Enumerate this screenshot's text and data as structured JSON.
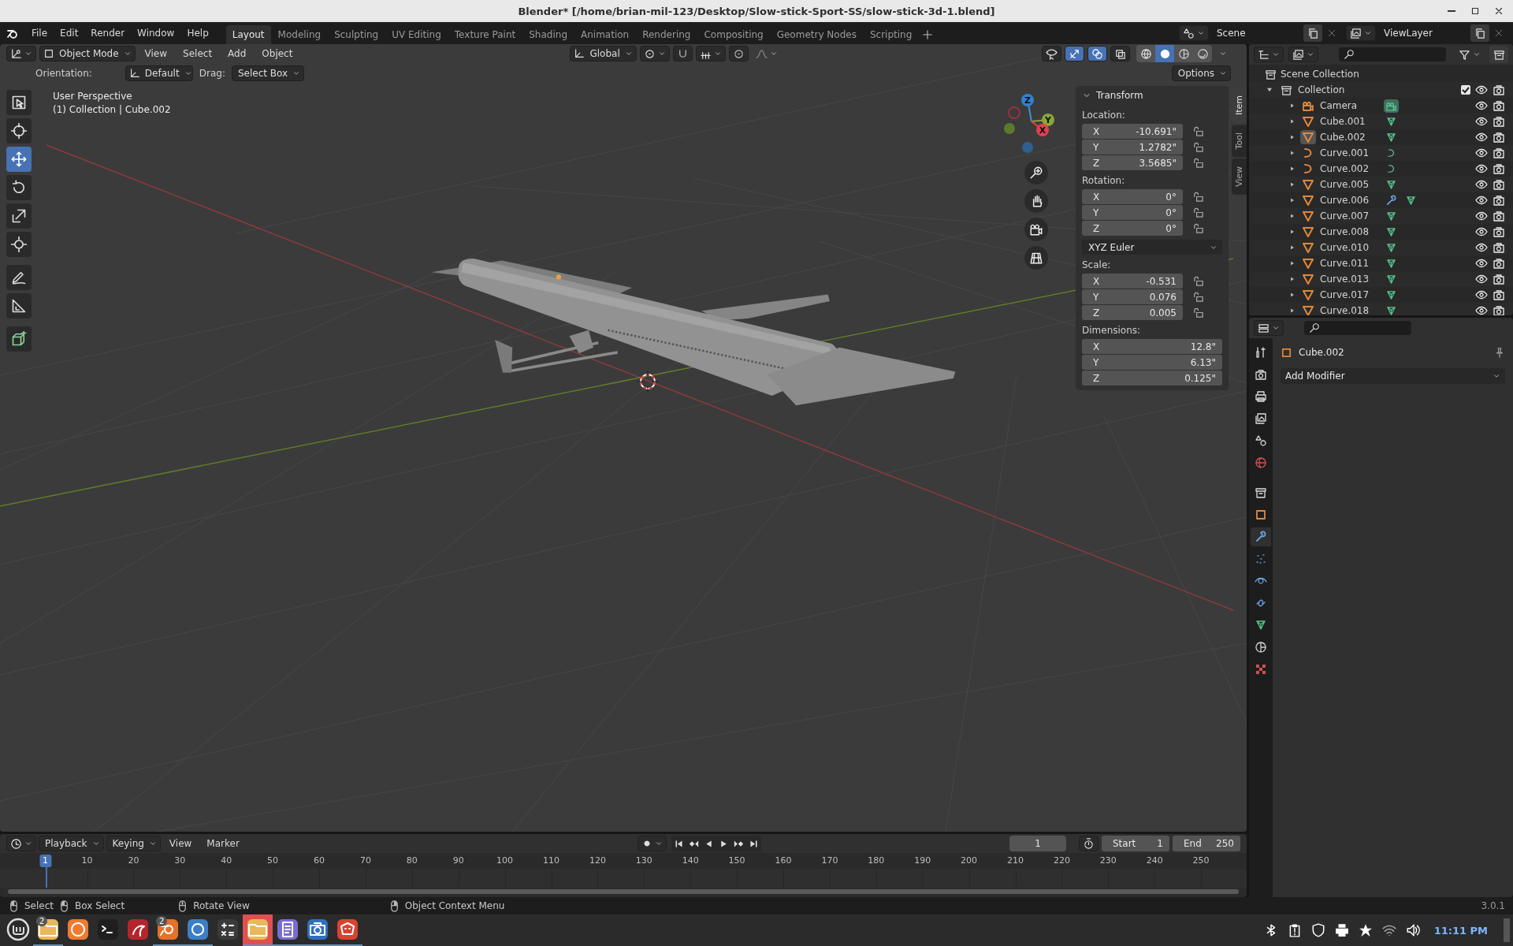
{
  "window": {
    "title": "Blender* [/home/brian-mil-123/Desktop/Slow-stick-Sport-SS/slow-stick-3d-1.blend]"
  },
  "menu": [
    "File",
    "Edit",
    "Render",
    "Window",
    "Help"
  ],
  "workspaces": [
    {
      "label": "Layout",
      "selected": true
    },
    {
      "label": "Modeling",
      "selected": false
    },
    {
      "label": "Sculpting",
      "selected": false
    },
    {
      "label": "UV Editing",
      "selected": false
    },
    {
      "label": "Texture Paint",
      "selected": false
    },
    {
      "label": "Shading",
      "selected": false
    },
    {
      "label": "Animation",
      "selected": false
    },
    {
      "label": "Rendering",
      "selected": false
    },
    {
      "label": "Compositing",
      "selected": false
    },
    {
      "label": "Geometry Nodes",
      "selected": false
    },
    {
      "label": "Scripting",
      "selected": false
    }
  ],
  "scene": {
    "name": "Scene"
  },
  "view_layer": {
    "name": "ViewLayer"
  },
  "viewport": {
    "mode": "Object Mode",
    "menus": [
      "View",
      "Select",
      "Add",
      "Object"
    ],
    "orientation": "Global",
    "toggles": [
      {
        "kind": "visibility",
        "on": false
      },
      {
        "kind": "gizmo",
        "on": true
      },
      {
        "kind": "overlay",
        "on": true
      },
      {
        "kind": "xray",
        "on": false
      }
    ],
    "shading": [
      {
        "kind": "wireframe",
        "selected": false
      },
      {
        "kind": "solid",
        "selected": true
      },
      {
        "kind": "material",
        "selected": false
      },
      {
        "kind": "rendered",
        "selected": false
      }
    ],
    "tool_settings": {
      "orientation_label": "Orientation:",
      "orientation": "Default",
      "drag_label": "Drag:",
      "drag": "Select Box",
      "options": "Options"
    },
    "info": [
      "User Perspective",
      "(1) Collection | Cube.002"
    ],
    "tools": [
      {
        "kind": "select",
        "selected": false
      },
      {
        "kind": "cursor",
        "selected": false
      },
      {
        "kind": "move",
        "selected": true
      },
      {
        "kind": "rotate",
        "selected": false
      },
      {
        "kind": "scale",
        "selected": false
      },
      {
        "kind": "transform",
        "selected": false
      },
      {
        "kind": "annotate",
        "selected": false
      },
      {
        "kind": "measure",
        "selected": false
      },
      {
        "kind": "addcube",
        "selected": false
      }
    ],
    "gizmo": {
      "axes": [
        "Z",
        "Y",
        "X"
      ]
    },
    "nav_buttons": [
      {
        "kind": "zoom"
      },
      {
        "kind": "pan"
      },
      {
        "kind": "cameranav"
      },
      {
        "kind": "ortho"
      }
    ]
  },
  "sidebar": {
    "tabs": [
      {
        "label": "Item",
        "selected": true
      },
      {
        "label": "Tool",
        "selected": false
      },
      {
        "label": "View",
        "selected": false
      }
    ],
    "panel": {
      "title": "Transform",
      "expanded": true,
      "groups": [
        {
          "label": "Location:",
          "fields": [
            {
              "axis": "X",
              "value": "-10.691\"",
              "locked": false
            },
            {
              "axis": "Y",
              "value": "1.2782\"",
              "locked": false
            },
            {
              "axis": "Z",
              "value": "3.5685\"",
              "locked": false
            }
          ]
        },
        {
          "label": "Rotation:",
          "fields": [
            {
              "axis": "X",
              "value": "0°",
              "locked": false
            },
            {
              "axis": "Y",
              "value": "0°",
              "locked": false
            },
            {
              "axis": "Z",
              "value": "0°",
              "locked": false
            }
          ],
          "mode": "XYZ Euler"
        },
        {
          "label": "Scale:",
          "fields": [
            {
              "axis": "X",
              "value": "-0.531",
              "locked": false
            },
            {
              "axis": "Y",
              "value": "0.076",
              "locked": false
            },
            {
              "axis": "Z",
              "value": "0.005",
              "locked": false
            }
          ]
        },
        {
          "label": "Dimensions:",
          "fields": [
            {
              "axis": "X",
              "value": "12.8\""
            },
            {
              "axis": "Y",
              "value": "6.13\""
            },
            {
              "axis": "Z",
              "value": "0.125\""
            }
          ]
        }
      ]
    }
  },
  "outliner": {
    "root": "Scene Collection",
    "collections": [
      {
        "name": "Collection",
        "expanded": true,
        "checked": true,
        "visible": true,
        "renderable": true,
        "children": [
          {
            "name": "Camera",
            "kind": "camera",
            "selected": false,
            "visible": true,
            "renderable": true,
            "data": [
              {
                "kind": "cameradata",
                "active": true
              }
            ]
          },
          {
            "name": "Cube.001",
            "kind": "mesh",
            "selected": false,
            "visible": true,
            "renderable": true,
            "data": [
              {
                "kind": "meshdata",
                "active": false
              }
            ]
          },
          {
            "name": "Cube.002",
            "kind": "mesh",
            "selected": true,
            "visible": true,
            "renderable": true,
            "data": [
              {
                "kind": "meshdata",
                "active": false
              }
            ]
          },
          {
            "name": "Curve.001",
            "kind": "curve",
            "selected": false,
            "visible": true,
            "renderable": true,
            "data": [
              {
                "kind": "curvedata",
                "active": false
              }
            ]
          },
          {
            "name": "Curve.002",
            "kind": "curve",
            "selected": false,
            "visible": true,
            "renderable": true,
            "data": [
              {
                "kind": "curvedata",
                "active": false
              }
            ]
          },
          {
            "name": "Curve.005",
            "kind": "mesh",
            "selected": false,
            "visible": true,
            "renderable": true,
            "data": [
              {
                "kind": "meshdata",
                "active": false
              }
            ]
          },
          {
            "name": "Curve.006",
            "kind": "mesh",
            "selected": false,
            "visible": true,
            "renderable": true,
            "data": [
              {
                "kind": "modifier",
                "active": false
              },
              {
                "kind": "meshdata",
                "active": false
              }
            ]
          },
          {
            "name": "Curve.007",
            "kind": "mesh",
            "selected": false,
            "visible": true,
            "renderable": true,
            "data": [
              {
                "kind": "meshdata",
                "active": false
              }
            ]
          },
          {
            "name": "Curve.008",
            "kind": "mesh",
            "selected": false,
            "visible": true,
            "renderable": true,
            "data": [
              {
                "kind": "meshdata",
                "active": false
              }
            ]
          },
          {
            "name": "Curve.010",
            "kind": "mesh",
            "selected": false,
            "visible": true,
            "renderable": true,
            "data": [
              {
                "kind": "meshdata",
                "active": false
              }
            ]
          },
          {
            "name": "Curve.011",
            "kind": "mesh",
            "selected": false,
            "visible": true,
            "renderable": true,
            "data": [
              {
                "kind": "meshdata",
                "active": false
              }
            ]
          },
          {
            "name": "Curve.013",
            "kind": "mesh",
            "selected": false,
            "visible": true,
            "renderable": true,
            "data": [
              {
                "kind": "meshdata",
                "active": false
              }
            ]
          },
          {
            "name": "Curve.017",
            "kind": "mesh",
            "selected": false,
            "visible": true,
            "renderable": true,
            "data": [
              {
                "kind": "meshdata",
                "active": false
              }
            ]
          },
          {
            "name": "Curve.018",
            "kind": "mesh",
            "selected": false,
            "visible": true,
            "renderable": true,
            "data": [
              {
                "kind": "meshdata",
                "active": false
              }
            ]
          }
        ]
      }
    ]
  },
  "properties": {
    "tabs": [
      {
        "kind": "tool",
        "selected": false
      },
      {
        "kind": "render",
        "selected": false
      },
      {
        "kind": "output",
        "selected": false
      },
      {
        "kind": "viewlayer",
        "selected": false
      },
      {
        "kind": "scene",
        "selected": false
      },
      {
        "kind": "world",
        "selected": false
      },
      {
        "kind": "collection",
        "selected": false
      },
      {
        "kind": "object",
        "selected": false
      },
      {
        "kind": "modifier",
        "selected": true
      },
      {
        "kind": "particles",
        "selected": false
      },
      {
        "kind": "physics",
        "selected": false
      },
      {
        "kind": "constraints",
        "selected": false
      },
      {
        "kind": "meshdata",
        "selected": false
      },
      {
        "kind": "material",
        "selected": false
      },
      {
        "kind": "texture",
        "selected": false
      }
    ],
    "object": "Cube.002",
    "pinned": false,
    "add_modifier": "Add Modifier"
  },
  "timeline": {
    "menus": [
      {
        "label": "Playback",
        "dropdown": true
      },
      {
        "label": "Keying",
        "dropdown": true
      },
      {
        "label": "View",
        "dropdown": false
      },
      {
        "label": "Marker",
        "dropdown": false
      }
    ],
    "current_frame": "1",
    "start_label": "Start",
    "start": "1",
    "end_label": "End",
    "end": "250",
    "playhead": "1",
    "ticks": [
      "10",
      "20",
      "30",
      "40",
      "50",
      "60",
      "70",
      "80",
      "90",
      "100",
      "110",
      "120",
      "130",
      "140",
      "150",
      "160",
      "170",
      "180",
      "190",
      "200",
      "210",
      "220",
      "230",
      "240",
      "250"
    ]
  },
  "status_bar": {
    "hints": [
      {
        "kind": "mouseleft",
        "label": "Select"
      },
      {
        "kind": "mouseleft",
        "label": "Box Select"
      },
      {
        "kind": "mousemiddle",
        "label": "Rotate View"
      },
      {
        "kind": "mouseright",
        "label": "Object Context Menu"
      }
    ],
    "version": "3.0.1"
  },
  "taskbar": {
    "apps": [
      {
        "kind": "files",
        "badge": "2",
        "running": true,
        "selected": false
      },
      {
        "kind": "firefox",
        "running": false,
        "selected": false
      },
      {
        "kind": "terminal",
        "running": false,
        "selected": false
      },
      {
        "kind": "dragon",
        "running": false,
        "selected": false
      },
      {
        "kind": "blender",
        "badge": "2",
        "running": true,
        "selected": false
      },
      {
        "kind": "chromium",
        "running": true,
        "selected": false
      },
      {
        "kind": "calculator",
        "running": false,
        "selected": false
      },
      {
        "kind": "folder",
        "running": true,
        "selected": true
      },
      {
        "kind": "editor",
        "running": true,
        "selected": false
      },
      {
        "kind": "screenshot",
        "running": true,
        "selected": false
      },
      {
        "kind": "gimp",
        "running": true,
        "selected": false
      }
    ],
    "tray": [
      {
        "kind": "bluetooth"
      },
      {
        "kind": "clipboard"
      },
      {
        "kind": "shield"
      },
      {
        "kind": "printer"
      },
      {
        "kind": "star"
      },
      {
        "kind": "wifi"
      },
      {
        "kind": "volume"
      }
    ],
    "clock": "11:11 PM"
  }
}
